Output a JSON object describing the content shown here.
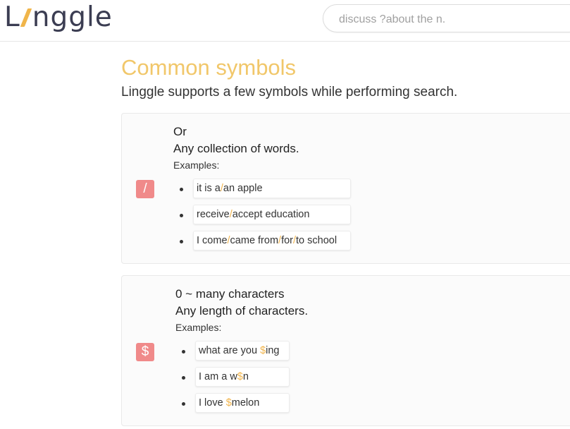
{
  "header": {
    "logo": {
      "prefix": "L",
      "suffix": "nggle"
    },
    "search": {
      "placeholder": "discuss ?about the n."
    }
  },
  "page": {
    "title": "Common symbols",
    "subtitle": "Linggle supports a few symbols while performing search."
  },
  "colors": {
    "title": "#f1c76a",
    "accent": "#f1b44c",
    "badge": "#f08a8a",
    "logo_slash": "#f0b54a"
  },
  "symbols": [
    {
      "badge": "/",
      "name": "Or",
      "description": "Any collection of words.",
      "examples_label": "Examples:",
      "examples": [
        {
          "parts": [
            {
              "t": "it is a"
            },
            {
              "t": "/",
              "sym": true
            },
            {
              "t": "an apple"
            }
          ]
        },
        {
          "parts": [
            {
              "t": "receive"
            },
            {
              "t": "/",
              "sym": true
            },
            {
              "t": "accept education"
            }
          ]
        },
        {
          "parts": [
            {
              "t": "I come"
            },
            {
              "t": "/",
              "sym": true
            },
            {
              "t": "came from"
            },
            {
              "t": "/",
              "sym": true
            },
            {
              "t": "for"
            },
            {
              "t": "/",
              "sym": true
            },
            {
              "t": "to school"
            }
          ]
        }
      ]
    },
    {
      "badge": "$",
      "name": "0 ~ many characters",
      "description": "Any length of characters.",
      "examples_label": "Examples:",
      "examples": [
        {
          "parts": [
            {
              "t": "what are you "
            },
            {
              "t": "$",
              "sym": true
            },
            {
              "t": "ing"
            }
          ]
        },
        {
          "parts": [
            {
              "t": "I am a w"
            },
            {
              "t": "$",
              "sym": true
            },
            {
              "t": "n"
            }
          ]
        },
        {
          "parts": [
            {
              "t": "I love "
            },
            {
              "t": "$",
              "sym": true
            },
            {
              "t": "melon"
            }
          ]
        }
      ]
    }
  ]
}
